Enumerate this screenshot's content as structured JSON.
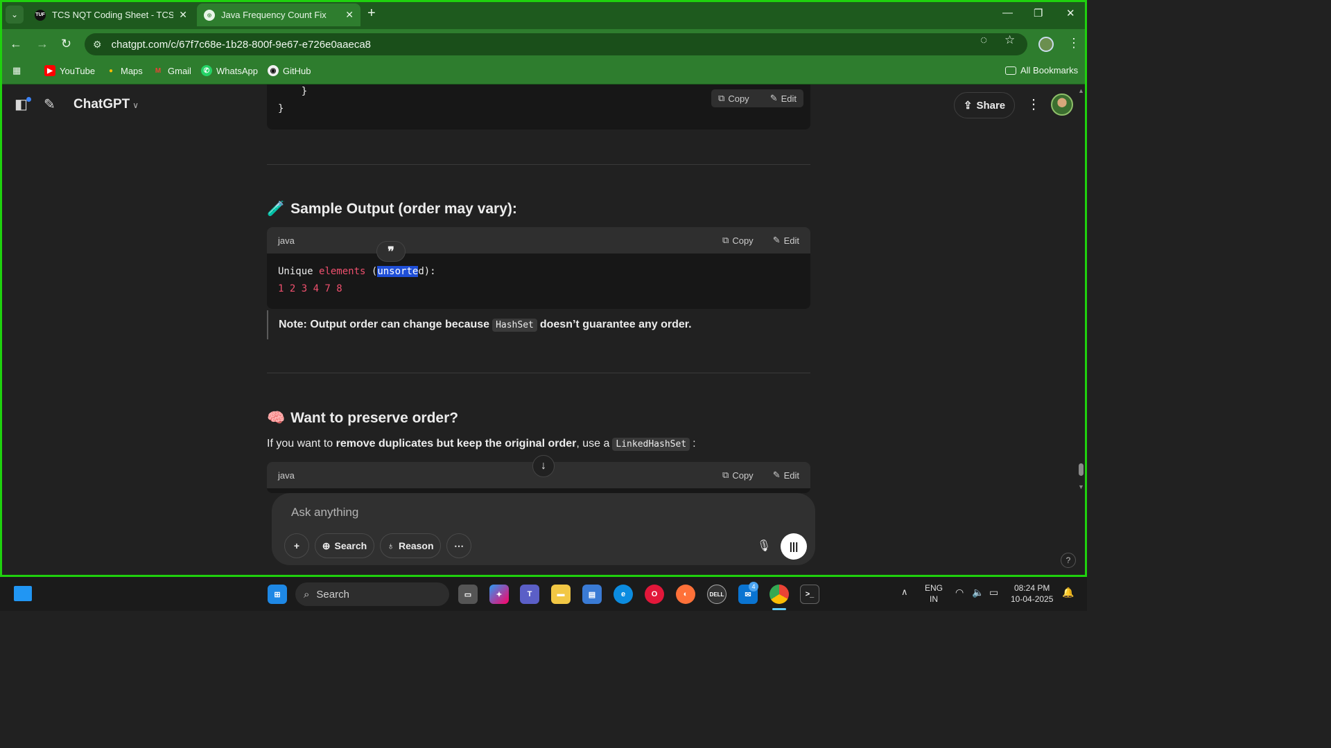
{
  "browser": {
    "tabs": [
      {
        "title": "TCS NQT Coding Sheet - TCS Co",
        "favicon": "TUF",
        "active": false
      },
      {
        "title": "Java Frequency Count Fix",
        "active": true
      }
    ],
    "url": "chatgpt.com/c/67f7c68e-1b28-800f-9e67-e726e0aaeca8",
    "bookmarks": [
      "YouTube",
      "Maps",
      "Gmail",
      "WhatsApp",
      "GitHub"
    ],
    "all_bookmarks": "All Bookmarks"
  },
  "app": {
    "brand": "ChatGPT",
    "share": "Share"
  },
  "top_code": {
    "lines": [
      "    }",
      "}"
    ],
    "copy": "Copy",
    "edit": "Edit"
  },
  "section1": {
    "emoji": "🧪",
    "title": "Sample Output (order may vary):"
  },
  "code1": {
    "lang": "java",
    "copy": "Copy",
    "edit": "Edit",
    "line1_a": "Unique ",
    "line1_b": "elements",
    "line1_c": " (",
    "line1_sel": "unsorte",
    "line1_d": "d):",
    "line2": "1 2 3 4 7 8"
  },
  "quote_icon": "❞",
  "note": {
    "prefix": "Note: Output order can change because",
    "code": "HashSet",
    "suffix": "doesn’t guarantee any order."
  },
  "section2": {
    "emoji": "🧠",
    "title": "Want to preserve order?"
  },
  "para": {
    "a": "If you want to ",
    "b": "remove duplicates but keep the original order",
    "c": ", use a",
    "code": "LinkedHashSet",
    "d": ":"
  },
  "code2": {
    "lang": "java",
    "copy": "Copy",
    "edit": "Edit"
  },
  "composer": {
    "placeholder": "Ask anything",
    "search": "Search",
    "reason": "Reason"
  },
  "help": "?",
  "taskbar": {
    "search": "Search",
    "lang1": "ENG",
    "lang2": "IN",
    "time": "08:24 PM",
    "date": "10-04-2025",
    "teams_badge": "4"
  }
}
